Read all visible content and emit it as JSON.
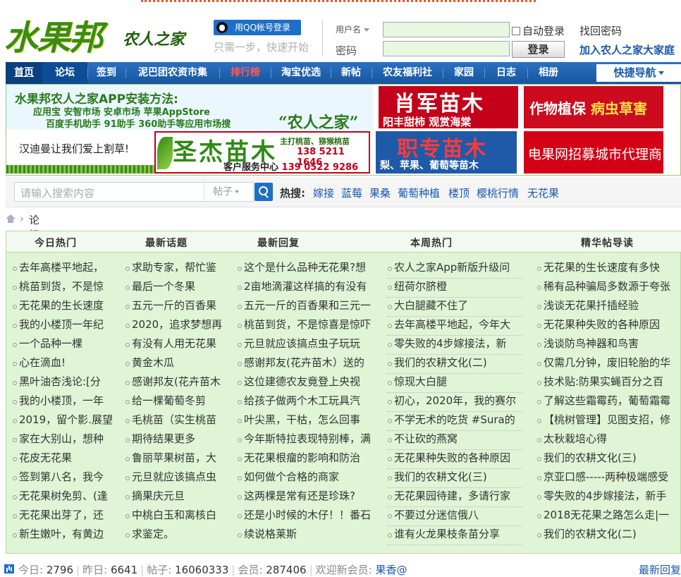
{
  "header": {
    "logo_main": "水果邦",
    "logo_sub": "农人之家",
    "qq_login": "用QQ帐号登录",
    "qq_tip": "只需一步，快速开始",
    "username_label": "用户名",
    "password_label": "密码",
    "auto_login": "自动登录",
    "find_password": "找回密码",
    "login_button": "登录",
    "join_link": "加入农人之家大家庭"
  },
  "nav": {
    "items": [
      "首页",
      "论坛",
      "签到",
      "泥巴团农资市集",
      "排行榜",
      "淘宝优选",
      "新帖",
      "农友福利社",
      "家园",
      "日志",
      "相册"
    ],
    "quick": "快捷导航"
  },
  "ads": {
    "app_title": "水果邦农人之家APP安装方法:",
    "app_line1": "应用宝  安智市场  安卓市场  苹果AppStore",
    "app_line2": "百度手机助手  91助手  360助手等应用市场搜",
    "app_quote": "“农人之家”",
    "xiao_big": "肖军苗木",
    "xiao_small": "阳丰甜柿  观赏海棠",
    "crop_a": "作物植保 ",
    "crop_b": "病虫草害",
    "han": "汉迪曼让我们爱上割草!",
    "sheng_big": "圣杰苗木",
    "sheng_r1": "主打桃苗、猕猴桃苗",
    "sheng_r2": "138 5211 1646",
    "sheng_r3a": "客户服务中心",
    "sheng_r3b": "139 0522 9286",
    "zhi_big": "职专苗木",
    "zhi_small": "梨、苹果、葡萄等苗木",
    "dian": "电果网招募城市代理商"
  },
  "search": {
    "placeholder": "请输入搜索内容",
    "type": "帖子",
    "hot_label": "热搜:",
    "hot_words": [
      "嫁接",
      "蓝莓",
      "果桑",
      "葡萄种植",
      "楼顶",
      "樱桃行情",
      "无花果"
    ]
  },
  "breadcrumb": {
    "current": "论坛"
  },
  "board": {
    "headers": [
      "今日热门",
      "最新话题",
      "最新回复",
      "本周热门",
      "精华帖导读"
    ],
    "col1": [
      "去年高楼平地起，",
      "桃苗到货，不是惊",
      "无花果的生长速度",
      "我的小楼顶一年纪",
      "一个品种一棵",
      "心在滴血!",
      "黑叶油杏浅论:[分",
      "我的小楼顶，一年",
      "2019，留个影.展望",
      "家在大别山，想种",
      "花皮无花果",
      "签到第八名，我今",
      "无花果树免剪、(逢",
      "无花果出芽了，还",
      "新生嫩叶，有黄边"
    ],
    "col2": [
      "求助专家，帮忙鉴",
      "最后一个冬果",
      "五元一斤的百香果",
      "2020，追求梦想再",
      "有没有人用无花果",
      "黄金木瓜",
      "感谢邦友(花卉苗木",
      "给一棵葡萄冬剪",
      "毛桃苗（实生桃苗",
      "期待结果更多",
      "鲁丽苹果树苗，大",
      "元旦就应该搞点虫",
      "摘果庆元旦",
      "中桃白玉和离核白",
      "求鉴定。"
    ],
    "col3": [
      "这个是什么品种无花果?想",
      "2亩地滴灌这样搞的有没有",
      "五元一斤的百香果和三元一",
      "桃苗到货，不是惊喜是惊吓",
      "元旦就应该搞点虫子玩玩",
      "感谢邦友(花卉苗木）送的",
      "这位建德农友竟登上央视",
      "给孩子做两个木工玩具汽",
      "叶尖黑，干枯，怎么回事",
      "今年斯特拉表现特别棒，满",
      "无花果根瘤的影响和防治",
      "如何做个合格的商家",
      "这两棵是常有还是珍珠?",
      "还是小时候的木仔！！番石",
      "续说格莱斯"
    ],
    "col4": [
      "农人之家App新版升级问",
      "纽荷尔脐橙",
      "大白腿藏不住了",
      "去年高楼平地起，今年大",
      "零失败的4步嫁接法，新",
      "我们的农耕文化(二)",
      "惊现大白腿",
      "初心，2020年，我的赛尔",
      "不学无术的吃货 #Sura的",
      "不让砍的燕窝",
      "无花果种失败的各种原因",
      "我们的农耕文化(三)",
      "无花果园待建，多请行家",
      "不要过分迷信俄八",
      "谁有火龙果枝条苗分享"
    ],
    "col5": [
      "无花果的生长速度有多快",
      "稀有品种骗局多数源于夸张",
      "浅谈无花果扦插经验",
      "无花果种失败的各种原因",
      "浅谈防鸟神器和鸟害",
      "仅需几分钟，废旧轮胎的华",
      "技术贴:防果实蝇百分之百",
      "了解这些霜霉药，葡萄霜霉",
      "【桃树管理】见图支招，修",
      "太秋栽培心得",
      "我们的农耕文化(三)",
      "京亚口感-----两种极端感受",
      "零失败的4步嫁接法，新手",
      "2018无花果之路怎么走|一",
      "我们的农耕文化(二)"
    ]
  },
  "footer": {
    "today_label": "今日:",
    "today": "2796",
    "yesterday_label": "昨日:",
    "yesterday": "6641",
    "posts_label": "帖子:",
    "posts": "16060333",
    "members_label": "会员:",
    "members": "287406",
    "welcome_label": "欢迎新会员:",
    "new_member": "果香@",
    "latest": "最新回复"
  }
}
